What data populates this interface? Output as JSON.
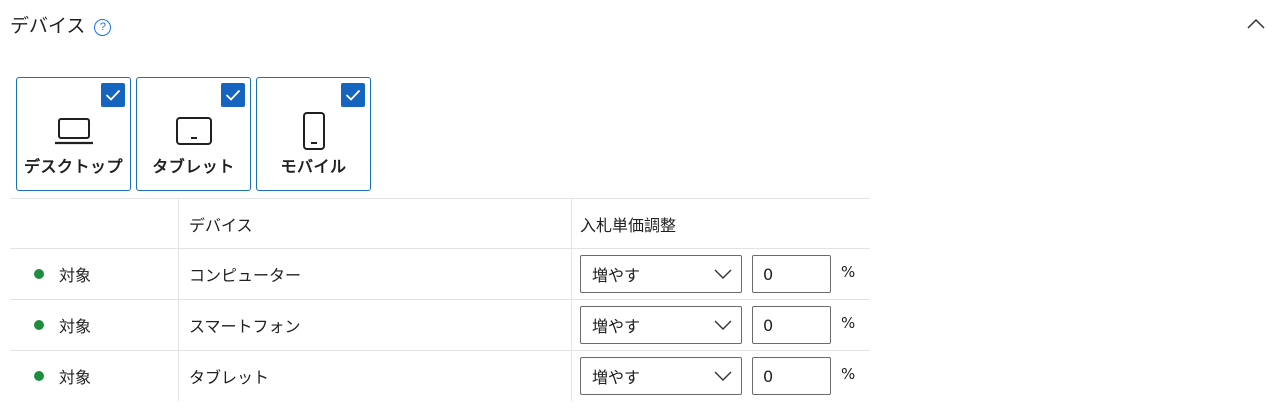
{
  "header": {
    "title": "デバイス",
    "help": "?"
  },
  "device_cards": [
    {
      "label": "デスクトップ",
      "icon": "laptop-icon",
      "checked": true
    },
    {
      "label": "タブレット",
      "icon": "tablet-icon",
      "checked": true
    },
    {
      "label": "モバイル",
      "icon": "mobile-phone-icon",
      "checked": true
    }
  ],
  "table": {
    "headers": [
      "",
      "デバイス",
      "入札単価調整"
    ],
    "rows": [
      {
        "status": "対象",
        "device": "コンピューター",
        "adjust": "増やす",
        "value": "0",
        "unit": "%"
      },
      {
        "status": "対象",
        "device": "スマートフォン",
        "adjust": "増やす",
        "value": "0",
        "unit": "%"
      },
      {
        "status": "対象",
        "device": "タブレット",
        "adjust": "増やす",
        "value": "0",
        "unit": "%"
      }
    ]
  },
  "colors": {
    "accent": "#1565c0",
    "card_border": "#1a73b8",
    "status_green": "#1e8e3e",
    "divider": "#e3e3e3"
  }
}
